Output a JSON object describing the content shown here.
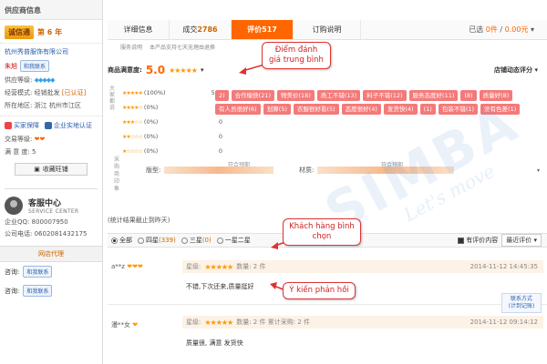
{
  "sidebar": {
    "header": "供应商信息",
    "cert_badge": "诚信通",
    "cert_years": "第 6 年",
    "shop_name": "杭州秀普服饰有限公司",
    "contact_name": "朱旭",
    "contact_btn": "和我联系",
    "supplier_level_label": "供应等级:",
    "supplier_level_icon": "◆◆◆◆◆",
    "mode_label": "经营模式:",
    "mode_value": "经销批发",
    "mode_tag": "[已认证]",
    "location_label": "所在地区:",
    "location_value": "浙江 杭州市江区",
    "guarantee_1": "买家保障",
    "guarantee_2": "企业实地认证",
    "trade_label": "交易等级:",
    "trade_icon": "❤❤",
    "satisfaction_label": "满 意 度:",
    "satisfaction_value": "5",
    "favorite_btn": "收藏旺铺",
    "service_title": "客服中心",
    "service_sub": "SERVICE CENTER",
    "qq_label": "企业QQ:",
    "qq_value": "800007950",
    "phone_label": "公司电话:",
    "phone_value": "0602081432175",
    "agent_header": "网店代理",
    "ask_label_1": "咨询:",
    "ask_label_2": "咨询:",
    "ask_btn": "和我联系"
  },
  "tabs": [
    {
      "label": "详细信息",
      "count": ""
    },
    {
      "label": "成交",
      "count": "2786"
    },
    {
      "label": "评价",
      "count": "517"
    },
    {
      "label": "订购说明",
      "count": ""
    }
  ],
  "cart": {
    "prefix": "已选",
    "qty": "0件",
    "sep": "/",
    "price": "0.00元",
    "arrow": "▾"
  },
  "subrow": {
    "item_1": "服务说明",
    "item_2": "本产品支持七天无理由退换"
  },
  "rating": {
    "label": "商品满意度:",
    "score": "5.0",
    "stars": "★★★★★",
    "store_dyn": "店铺动态评分 ▾"
  },
  "distribution": {
    "side_label": "大家都说",
    "rows": [
      {
        "stars": "★★★★★",
        "pct": "(100%)",
        "num": "517"
      },
      {
        "stars": "★★★★☆",
        "pct": "(0%)",
        "num": "0"
      },
      {
        "stars": "★★★☆☆",
        "pct": "(0%)",
        "num": "0"
      },
      {
        "stars": "★★☆☆☆",
        "pct": "(0%)",
        "num": "0"
      },
      {
        "stars": "★☆☆☆☆",
        "pct": "(0%)",
        "num": "0"
      }
    ]
  },
  "tags": [
    "2)",
    "合作愉快(21)",
    "物美价(18)",
    "质工不错(13)",
    "料子不错(12)",
    "服务态度好(11)",
    "(8)",
    "质量好(8)",
    "有人员很好(6)",
    "划算(5)",
    "衣服很好看(5)",
    "态度很好(4)",
    "发货快(4)",
    "(1)",
    "包装不错(1)",
    "没有色差(1)"
  ],
  "impression": {
    "side_label": "采购商印象",
    "model_label": "版型:",
    "model_bar_label": "符合预期",
    "material_label": "材质:",
    "material_bar_label": "符合预期",
    "expand": "▾"
  },
  "stats_note": "(统计结果截止到昨天)",
  "filter": {
    "all": "全部",
    "four_star": "四星",
    "four_star_count": "(339)",
    "three_star": "三星",
    "three_star_count": "(0)",
    "one_two_star": "一星二星",
    "with_content": "有评价内容",
    "sort": "最近评价 ▾"
  },
  "reviews": [
    {
      "user": "a**z",
      "user_icon": "❤❤❤",
      "rating_label": "星级:",
      "stars": "★★★★★",
      "qty": "数量: 2 件",
      "date": "2014-11-12 14:45:35",
      "text": "不错,下次还来,质量挺好"
    },
    {
      "user": "漫**女",
      "user_icon": "❤",
      "rating_label": "星级:",
      "stars": "★★★★★",
      "qty": "数量: 2 件   累计采购: 2 件",
      "date": "2014-11-12 09:14:12",
      "text": "质量很, 满意 发货快"
    }
  ],
  "float_contact": {
    "line_1": "联系方式",
    "line_2": "(计到记账)"
  },
  "watermark": {
    "main": "SIMBA",
    "sub": "Let's move"
  },
  "callouts": {
    "avg_rating": "Điểm đánh\ngiá trung bình",
    "buyer_choice": "Khách hàng bình\nchọn",
    "feedback": "Ý kiến phản hồi"
  },
  "colors": {
    "accent": "#ff6600",
    "tag": "#f47a7a",
    "callout": "#d33333"
  }
}
